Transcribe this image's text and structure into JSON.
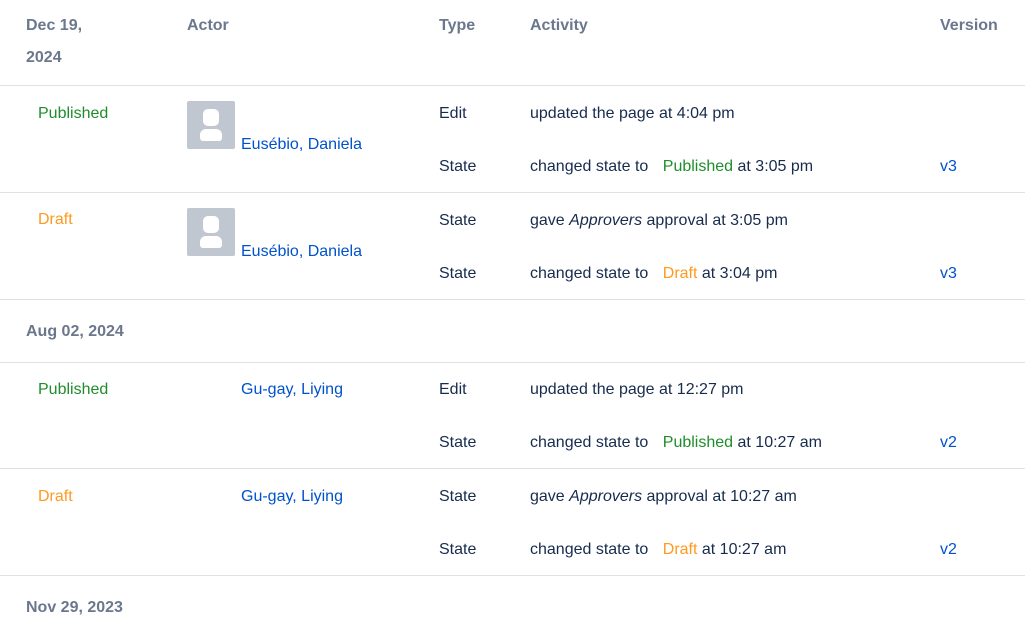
{
  "headers": {
    "date": "Dec 19,",
    "date_line2": "2024",
    "actor": "Actor",
    "type": "Type",
    "activity": "Activity",
    "version": "Version"
  },
  "groups": [
    {
      "rows": [
        {
          "state": "Published",
          "actor": "Eusébio, Daniela",
          "activities": [
            {
              "type": "Edit",
              "text": "updated the page at 4:04 pm"
            },
            {
              "type": "State",
              "prefix": "changed state to",
              "state": "Published",
              "suffix": "at 3:05 pm",
              "version": "v3"
            }
          ]
        },
        {
          "state": "Draft",
          "actor": "Eusébio, Daniela",
          "activities": [
            {
              "type": "State",
              "prefix": "gave",
              "em": "Approvers",
              "suffix": "approval at 3:05 pm"
            },
            {
              "type": "State",
              "prefix": "changed state to",
              "state": "Draft",
              "suffix": "at 3:04 pm",
              "version": "v3"
            }
          ]
        }
      ]
    },
    {
      "date": "Aug 02, 2024",
      "rows": [
        {
          "state": "Published",
          "actor": "Gu-gay, Liying",
          "activities": [
            {
              "type": "Edit",
              "text": "updated the page at 12:27 pm"
            },
            {
              "type": "State",
              "prefix": "changed state to",
              "state": "Published",
              "suffix": "at 10:27 am",
              "version": "v2"
            }
          ]
        },
        {
          "state": "Draft",
          "actor": "Gu-gay, Liying",
          "activities": [
            {
              "type": "State",
              "prefix": "gave",
              "em": "Approvers",
              "suffix": "approval at 10:27 am"
            },
            {
              "type": "State",
              "prefix": "changed state to",
              "state": "Draft",
              "suffix": "at 10:27 am",
              "version": "v2"
            }
          ]
        }
      ]
    },
    {
      "date": "Nov 29, 2023"
    }
  ],
  "colors": {
    "published": "#1f8d2b",
    "draft": "#ff991f",
    "link": "#0052cc",
    "header": "#6b778c",
    "divider": "#dfe1e6"
  },
  "icons": {
    "avatar": "default-user-avatar-icon"
  }
}
